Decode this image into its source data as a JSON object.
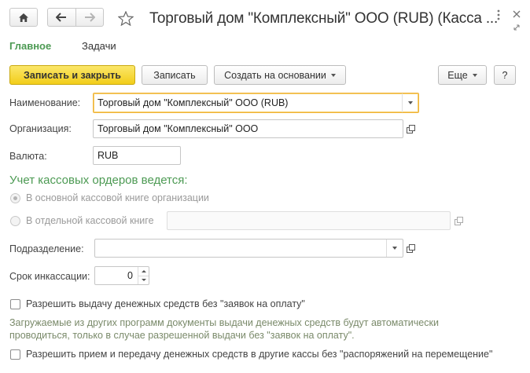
{
  "window": {
    "title": "Торговый дом \"Комплексный\" ООО (RUB) (Касса ...",
    "icons": {
      "home": "home-icon",
      "back": "arrow-left-icon",
      "forward": "arrow-right-icon",
      "favorite": "star-icon",
      "more": "more-vertical-icon",
      "resize": "resize-icon",
      "close": "close-icon"
    }
  },
  "tabs": [
    {
      "label": "Главное",
      "active": true
    },
    {
      "label": "Задачи",
      "active": false
    }
  ],
  "toolbar": {
    "save_close": "Записать и закрыть",
    "save": "Записать",
    "create_based_on": "Создать на основании",
    "more": "Еще",
    "help": "?"
  },
  "form": {
    "name_label": "Наименование:",
    "name_value": "Торговый дом \"Комплексный\" ООО (RUB)",
    "org_label": "Организация:",
    "org_value": "Торговый дом \"Комплексный\" ООО",
    "currency_label": "Валюта:",
    "currency_value": "RUB",
    "section_title": "Учет кассовых ордеров ведется:",
    "radio_main": "В основной кассовой книге организации",
    "radio_separate": "В отдельной кассовой книге",
    "separate_value": "",
    "dept_label": "Подразделение:",
    "dept_value": "",
    "collect_label": "Срок инкассации:",
    "collect_value": "0",
    "check1_label": "Разрешить выдачу денежных средств без \"заявок на оплату\"",
    "check1_checked": false,
    "hint_line1": "Загружаемые из других программ документы выдачи денежных средств будут автоматически",
    "hint_line2": "проводиться, только в случае разрешенной выдачи без \"заявок на оплату\".",
    "check2_label": "Разрешить прием и передачу денежных средств в другие кассы без \"распоряжений на перемещение\"",
    "check2_checked": false
  },
  "colors": {
    "accent_green": "#4c9a53",
    "primary_button": "#f2cd1a",
    "focus_border": "#f0b43a"
  }
}
